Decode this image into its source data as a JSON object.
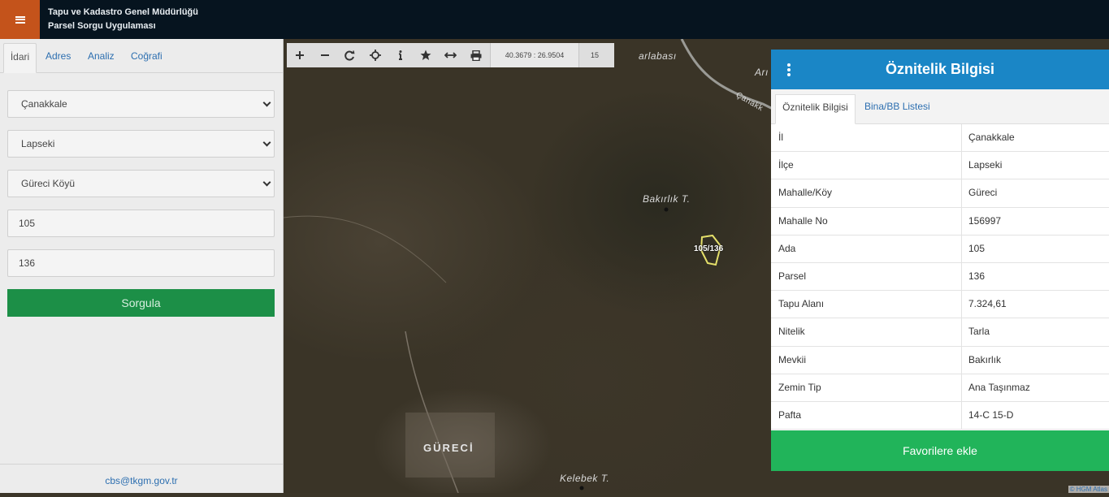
{
  "header": {
    "title_line1": "Tapu ve Kadastro Genel Müdürlüğü",
    "title_line2": "Parsel Sorgu Uygulaması",
    "accent_color": "#c4531b",
    "menu_icon": "hamburger-icon"
  },
  "left_panel": {
    "tabs": [
      {
        "label": "İdari"
      },
      {
        "label": "Adres"
      },
      {
        "label": "Analiz"
      },
      {
        "label": "Coğrafi"
      }
    ],
    "province_select": "Çanakkale",
    "district_select": "Lapseki",
    "neighborhood_select": "Güreci Köyü",
    "block_input": "105",
    "parcel_input": "136",
    "query_button": "Sorgula",
    "footer_email": "cbs@tkgm.gov.tr"
  },
  "toolbar": {
    "icons": [
      "plus-icon",
      "minus-icon",
      "refresh-icon",
      "crosshair-icon",
      "info-icon",
      "star-icon",
      "measure-icon",
      "print-icon"
    ],
    "coordinates": "40.3679 : 26.9504",
    "zoom": "15"
  },
  "map": {
    "labels": {
      "top_label": "arlabası",
      "peak1": "Bakırlık T.",
      "parcel": "105/136",
      "town": "GÜRECİ",
      "peak2": "Kelebek T.",
      "corner_top": "Arı",
      "road": "Çanakk"
    },
    "attribution": "© HGM Atlas",
    "parcel_color": "#e5e06a"
  },
  "attribute_panel": {
    "title": "Öznitelik Bilgisi",
    "tabs": [
      "Öznitelik Bilgisi",
      "Bina/BB Listesi"
    ],
    "rows": [
      {
        "key": "İl",
        "value": "Çanakkale"
      },
      {
        "key": "İlçe",
        "value": "Lapseki"
      },
      {
        "key": "Mahalle/Köy",
        "value": "Güreci"
      },
      {
        "key": "Mahalle No",
        "value": "156997"
      },
      {
        "key": "Ada",
        "value": "105"
      },
      {
        "key": "Parsel",
        "value": "136"
      },
      {
        "key": "Tapu Alanı",
        "value": "7.324,61"
      },
      {
        "key": "Nitelik",
        "value": "Tarla"
      },
      {
        "key": "Mevkii",
        "value": "Bakırlık"
      },
      {
        "key": "Zemin Tip",
        "value": "Ana Taşınmaz"
      },
      {
        "key": "Pafta",
        "value": "14-C 15-D"
      }
    ],
    "favorite_button": "Favorilere ekle",
    "header_color": "#1a86c6",
    "button_color": "#21b45a"
  }
}
